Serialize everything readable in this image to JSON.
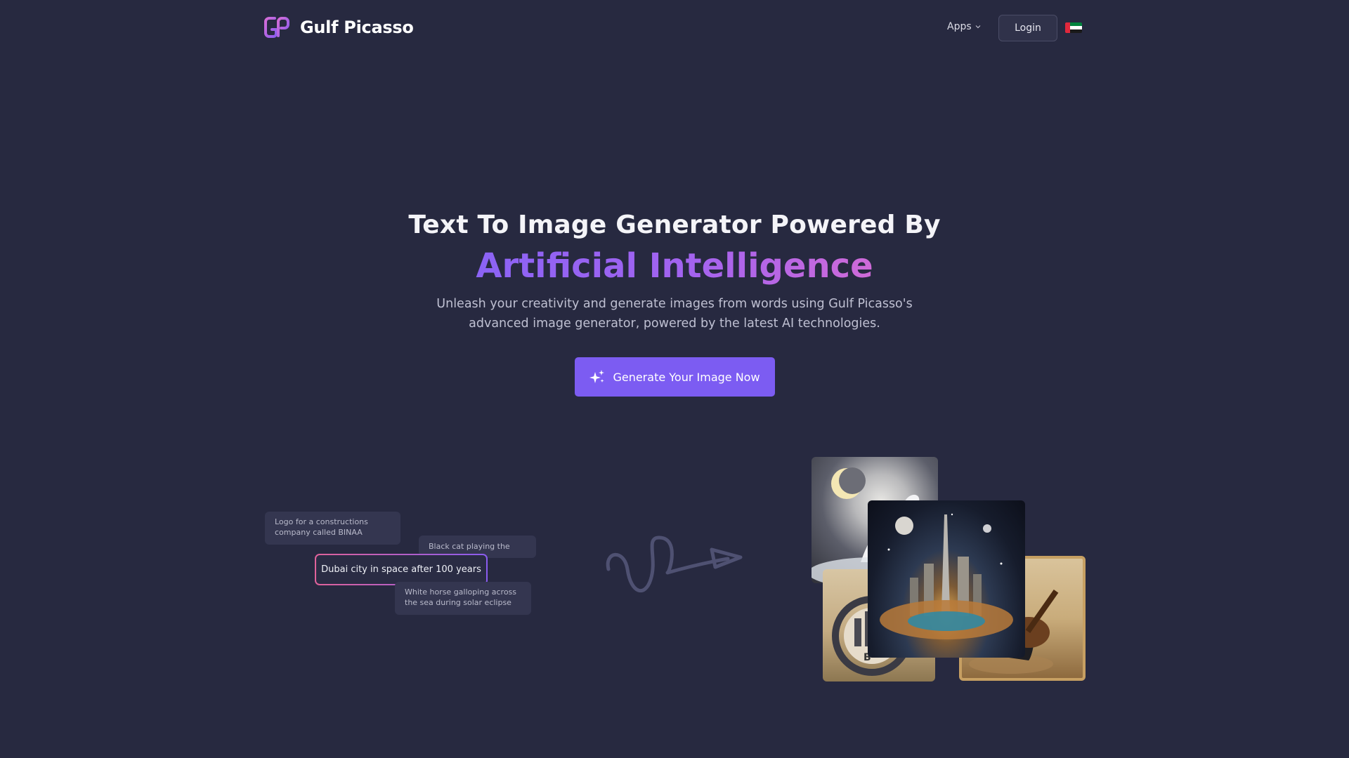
{
  "header": {
    "brand": "Gulf Picasso",
    "apps_label": "Apps",
    "login_label": "Login",
    "language_flag": "uae-flag"
  },
  "hero": {
    "title": "Text To Image Generator Powered By",
    "accent": "Artificial Intelligence",
    "subtitle": "Unleash your creativity and generate images from words using Gulf Picasso's advanced image generator, powered by the latest AI technologies.",
    "cta_label": "Generate Your Image Now",
    "cta_icon": "sparkles-icon"
  },
  "prompts": [
    "Logo for a constructions company called BINAA",
    "Black cat playing the Oud",
    "Dubai city in space after 100 years",
    "White horse galloping across the sea during solar eclipse"
  ],
  "gallery": {
    "images": [
      "white-horse-eclipse-image",
      "binaa-logo-image",
      "black-cat-oud-image",
      "dubai-space-city-image"
    ],
    "logo_tile_letter": "B"
  },
  "colors": {
    "background": "#272940",
    "accent": "#7c5cf2",
    "accent_gradient_end": "#cf6ad8"
  }
}
